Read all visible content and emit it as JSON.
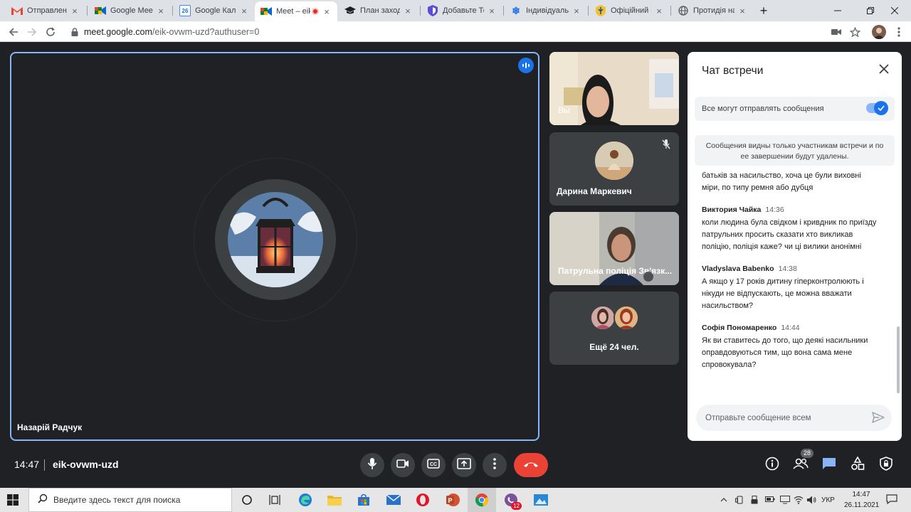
{
  "browser": {
    "tabs": [
      {
        "title": "Отправленные",
        "icon": "gmail-icon",
        "active": false
      },
      {
        "title": "Google Meet",
        "icon": "meet-icon",
        "active": false
      },
      {
        "title": "Google Календарь",
        "icon": "calendar-icon",
        "active": false
      },
      {
        "title": "Meet – eik",
        "icon": "meet-icon",
        "active": true
      },
      {
        "title": "План заходів",
        "icon": "graduation-cap-icon",
        "active": false
      },
      {
        "title": "Добавьте Текст",
        "icon": "shield-icon",
        "active": false
      },
      {
        "title": "Індивідуальне",
        "icon": "snowflake-icon",
        "active": false
      },
      {
        "title": "Офіційний са",
        "icon": "emblem-icon",
        "active": false
      },
      {
        "title": "Протидія нас",
        "icon": "globe-icon",
        "active": false
      }
    ],
    "calendar_day": "26",
    "url_host": "meet.google.com",
    "url_path": "/eik-ovwm-uzd?authuser=0"
  },
  "meet": {
    "main_speaker": "Назарій Радчук",
    "tiles": [
      {
        "name": "Вы"
      },
      {
        "name": "Дарина Маркевич"
      },
      {
        "name": "Патрульна поліція Зв'язк..."
      },
      {
        "name": "Ещё 24 чел."
      }
    ],
    "clock": "14:47",
    "meeting_code": "eik-ovwm-uzd",
    "participants_count": "28",
    "accent": "#8ab4f8",
    "end_call_color": "#ea4335"
  },
  "chat": {
    "title": "Чат встречи",
    "permission_label": "Все могут отправлять сообщения",
    "permission_enabled": true,
    "notice": "Сообщения видны только участникам встречи и по ее завершении будут удалены.",
    "partial_message": {
      "text": "батьків за насильство, хоча це були виховні міри, по типу ремня або дубця"
    },
    "messages": [
      {
        "sender": "Виктория Чайка",
        "time": "14:36",
        "text": "коли людина була свідком і кривдник по приїзду патрульних  просить сказати хто викликав поліцію,  поліція каже? чи ці вилики анонімні"
      },
      {
        "sender": "Vladyslava Babenko",
        "time": "14:38",
        "text": "А якщо у 17 років дитину гіперконтролюють і нікуди не відпускають, це можна вважати насильством?"
      },
      {
        "sender": "Софія Пономаренко",
        "time": "14:44",
        "text": "Як ви ставитесь до того, що деякі насильники оправдовуються тим, що вона сама мене спровокувала?"
      }
    ],
    "input_placeholder": "Отправьте сообщение всем"
  },
  "taskbar": {
    "search_placeholder": "Введите здесь текст для поиска",
    "viber_badge": "12",
    "language": "УКР",
    "time": "14:47",
    "date": "26.11.2021"
  }
}
